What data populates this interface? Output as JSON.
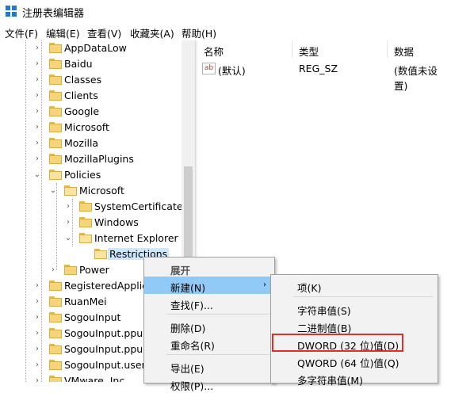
{
  "window": {
    "title": "注册表编辑器"
  },
  "menubar": [
    {
      "label": "文件(F)"
    },
    {
      "label": "编辑(E)"
    },
    {
      "label": "查看(V)"
    },
    {
      "label": "收藏夹(A)"
    },
    {
      "label": "帮助(H)"
    }
  ],
  "tree": {
    "items": [
      {
        "label": "AppDataLow"
      },
      {
        "label": "Baidu"
      },
      {
        "label": "Classes"
      },
      {
        "label": "Clients"
      },
      {
        "label": "Google"
      },
      {
        "label": "Microsoft"
      },
      {
        "label": "Mozilla"
      },
      {
        "label": "MozillaPlugins"
      },
      {
        "label": "Policies"
      },
      {
        "label": "Microsoft"
      },
      {
        "label": "SystemCertificates"
      },
      {
        "label": "Windows"
      },
      {
        "label": "Internet Explorer"
      },
      {
        "label": "Restrictions"
      },
      {
        "label": "Power"
      },
      {
        "label": "RegisteredApplic"
      },
      {
        "label": "RuanMei"
      },
      {
        "label": "SogouInput"
      },
      {
        "label": "SogouInput.ppup"
      },
      {
        "label": "SogouInput.ppup"
      },
      {
        "label": "SogouInput.user"
      },
      {
        "label": "VMware, Inc."
      }
    ]
  },
  "list": {
    "columns": {
      "name": "名称",
      "type": "类型",
      "data": "数据"
    },
    "rows": [
      {
        "name": "(默认)",
        "type": "REG_SZ",
        "data": "(数值未设置)",
        "icon": "string-value-icon"
      }
    ]
  },
  "context_menu": {
    "items": [
      {
        "label": "展开"
      },
      {
        "label": "新建(N)"
      },
      {
        "label": "查找(F)..."
      },
      {
        "label": "删除(D)"
      },
      {
        "label": "重命名(R)"
      },
      {
        "label": "导出(E)"
      },
      {
        "label": "权限(P)..."
      }
    ]
  },
  "submenu": {
    "items": [
      {
        "label": "项(K)"
      },
      {
        "label": "字符串值(S)"
      },
      {
        "label": "二进制值(B)"
      },
      {
        "label": "DWORD (32 位)值(D)"
      },
      {
        "label": "QWORD (64 位)值(Q)"
      },
      {
        "label": "多字符串值(M)"
      }
    ]
  },
  "colors": {
    "highlight_border": "#e0302a",
    "menu_hover": "#91c9f7",
    "selection": "#cce8ff"
  }
}
